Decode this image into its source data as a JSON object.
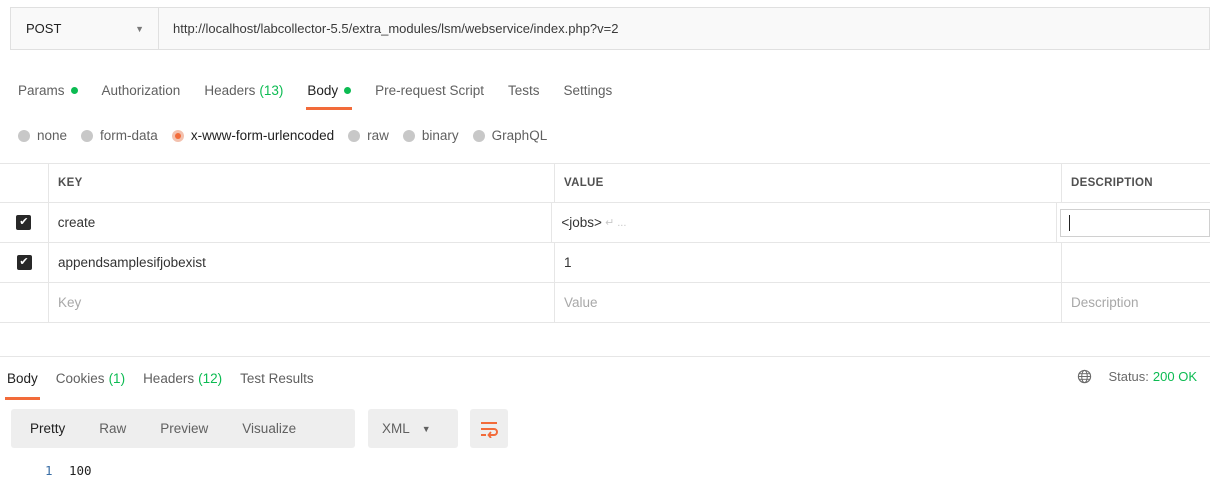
{
  "request": {
    "method": "POST",
    "url": "http://localhost/labcollector-5.5/extra_modules/lsm/webservice/index.php?v=2"
  },
  "request_tabs": [
    {
      "label": "Params",
      "dot": true
    },
    {
      "label": "Authorization"
    },
    {
      "label": "Headers",
      "count": "(13)"
    },
    {
      "label": "Body",
      "dot": true,
      "active": true
    },
    {
      "label": "Pre-request Script"
    },
    {
      "label": "Tests"
    },
    {
      "label": "Settings"
    }
  ],
  "body_types": [
    {
      "label": "none"
    },
    {
      "label": "form-data"
    },
    {
      "label": "x-www-form-urlencoded",
      "selected": true
    },
    {
      "label": "raw"
    },
    {
      "label": "binary"
    },
    {
      "label": "GraphQL"
    }
  ],
  "params_table": {
    "headers": {
      "key": "KEY",
      "value": "VALUE",
      "description": "DESCRIPTION"
    },
    "rows": [
      {
        "checked": true,
        "key": "create",
        "value": "<jobs>",
        "value_hint": "↵ ...",
        "description": ""
      },
      {
        "checked": true,
        "key": "appendsamplesifjobexist",
        "value": "1",
        "description": ""
      }
    ],
    "placeholders": {
      "key": "Key",
      "value": "Value",
      "description": "Description"
    }
  },
  "response_tabs": [
    {
      "label": "Body",
      "active": true
    },
    {
      "label": "Cookies",
      "count": "(1)"
    },
    {
      "label": "Headers",
      "count": "(12)"
    },
    {
      "label": "Test Results"
    }
  ],
  "status": {
    "label": "Status:",
    "value": "200 OK",
    "icon": "globe-icon"
  },
  "view_modes": [
    "Pretty",
    "Raw",
    "Preview",
    "Visualize"
  ],
  "format": {
    "selected": "XML"
  },
  "wrap_icon": "wrap-lines-icon",
  "response_body": {
    "line_number": "1",
    "text": "100"
  },
  "colors": {
    "accent": "#f26b3a",
    "success": "#0cbb52"
  }
}
